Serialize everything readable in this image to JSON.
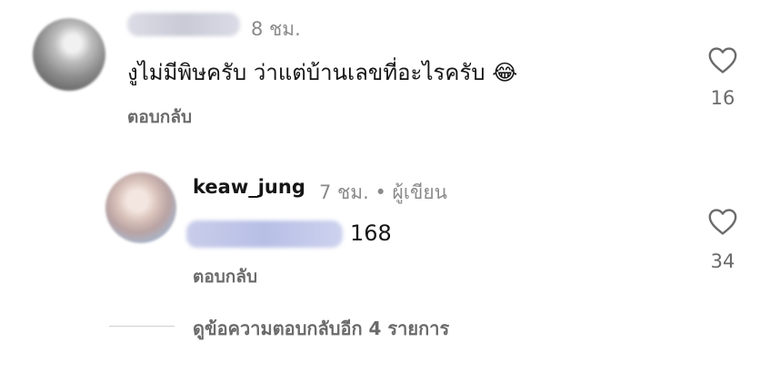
{
  "comment": {
    "time": "8 ชม.",
    "text": "งูไม่มีพิษครับ ว่าแต่บ้านเลขที่อะไรครับ",
    "emoji": "😂",
    "reply_label": "ตอบกลับ",
    "like_count": "16"
  },
  "reply": {
    "username": "keaw_jung",
    "time": "7 ชม. • ผู้เขียน",
    "text": "168",
    "reply_label": "ตอบกลับ",
    "like_count": "34"
  },
  "view_more": "ดูข้อความตอบกลับอีก 4 รายการ",
  "icons": {
    "like": "heart-icon"
  }
}
